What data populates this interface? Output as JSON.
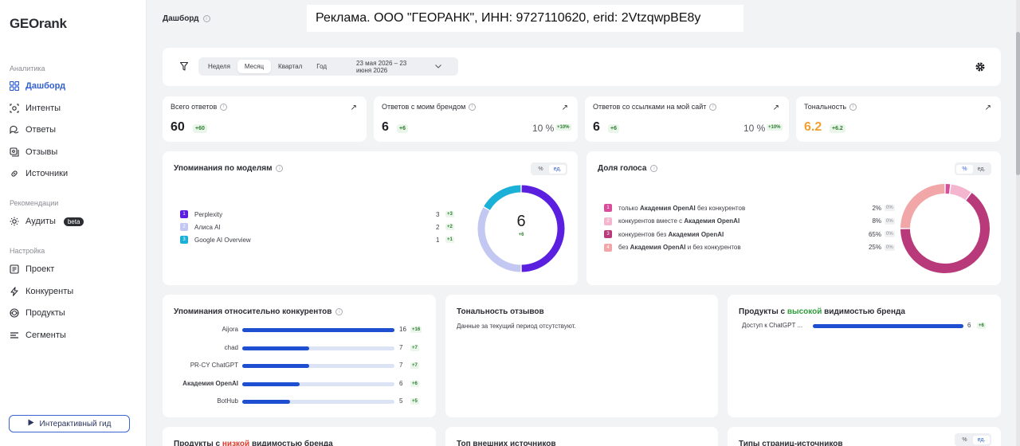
{
  "app": {
    "logo": "GEOrank"
  },
  "ad": "Реклама. ООО \"ГЕОРАНК\", ИНН: 9727110620, erid: 2VtzqwpBE8y",
  "sidebar": {
    "sections": [
      {
        "title": "Аналитика"
      },
      {
        "title": "Рекомендации"
      },
      {
        "title": "Настройка"
      }
    ],
    "items": [
      {
        "label": "Дашборд",
        "icon": "dashboard-icon"
      },
      {
        "label": "Интенты",
        "icon": "intents-icon"
      },
      {
        "label": "Ответы",
        "icon": "answers-icon"
      },
      {
        "label": "Отзывы",
        "icon": "reviews-icon"
      },
      {
        "label": "Источники",
        "icon": "sources-icon"
      },
      {
        "label": "Аудиты",
        "icon": "sun-icon",
        "badge": "beta"
      },
      {
        "label": "Проект",
        "icon": "project-icon"
      },
      {
        "label": "Конкуренты",
        "icon": "lightning-icon"
      },
      {
        "label": "Продукты",
        "icon": "products-icon"
      },
      {
        "label": "Сегменты",
        "icon": "segments-icon"
      }
    ],
    "guide_button": "Интерактивный гид"
  },
  "header": {
    "title": "Дашборд"
  },
  "filters": {
    "periods": [
      "Неделя",
      "Месяц",
      "Квартал",
      "Год"
    ],
    "selected": "Месяц",
    "date_range": "23 мая 2026 – 23 июня 2026"
  },
  "kpis": [
    {
      "title": "Всего ответов",
      "value": "60",
      "delta": "+60"
    },
    {
      "title": "Ответов с моим брендом",
      "value": "6",
      "delta": "+6",
      "pct": "10 %",
      "pct_delta": "+10%"
    },
    {
      "title": "Ответов со ссылками на мой сайт",
      "value": "6",
      "delta": "+6",
      "pct": "10 %",
      "pct_delta": "+10%"
    },
    {
      "title": "Тональность",
      "value": "6.2",
      "delta": "+6.2",
      "value_color": "#f0a030"
    }
  ],
  "mentions_by_model": {
    "title": "Упоминания по моделям",
    "toggle": [
      "%",
      "ед."
    ],
    "total": "6",
    "total_delta": "+6",
    "rows": [
      {
        "n": "1",
        "name": "Perplexity",
        "value": 3,
        "value_text": "3",
        "delta": "+3",
        "color": "#5b1fe0"
      },
      {
        "n": "2",
        "name": "Алиса AI",
        "value": 2,
        "value_text": "2",
        "delta": "+2",
        "color": "#c2c8f2"
      },
      {
        "n": "3",
        "name": "Google AI Overview",
        "value": 1,
        "value_text": "1",
        "delta": "+1",
        "color": "#1bb0d8"
      }
    ]
  },
  "voice_share": {
    "title": "Доля голоса",
    "toggle": [
      "%",
      "ед."
    ],
    "rows": [
      {
        "n": "1",
        "pre": "только ",
        "bold": "Академия OpenAI",
        "post": " без конкурентов",
        "value": 2,
        "pct": "2%",
        "change": "0%",
        "color": "#d84d9a"
      },
      {
        "n": "2",
        "pre": "конкурентов вместе с ",
        "bold": "Академия OpenAI",
        "post": "",
        "value": 8,
        "pct": "8%",
        "change": "0%",
        "color": "#f4b6cf"
      },
      {
        "n": "3",
        "pre": "конкурентов без ",
        "bold": "Академия OpenAI",
        "post": "",
        "value": 65,
        "pct": "65%",
        "change": "0%",
        "color": "#b83a7a"
      },
      {
        "n": "4",
        "pre": "без ",
        "bold": "Академия OpenAI",
        "post": " и без конкурентов",
        "value": 25,
        "pct": "25%",
        "change": "0%",
        "color": "#f1a6a8"
      }
    ]
  },
  "competitor_mentions": {
    "title": "Упоминания относительно конкурентов",
    "max": 16,
    "rows": [
      {
        "name": "Aijora",
        "value": 16,
        "value_text": "16",
        "delta": "+16",
        "bold": false
      },
      {
        "name": "chad",
        "value": 7,
        "value_text": "7",
        "delta": "+7",
        "bold": false
      },
      {
        "name": "PR-CY ChatGPT",
        "value": 7,
        "value_text": "7",
        "delta": "+7",
        "bold": false
      },
      {
        "name": "Академия OpenAI",
        "value": 6,
        "value_text": "6",
        "delta": "+6",
        "bold": true
      },
      {
        "name": "BotHub",
        "value": 5,
        "value_text": "5",
        "delta": "+5",
        "bold": false
      }
    ]
  },
  "reviews_tone": {
    "title": "Тональность отзывов",
    "empty": "Данные за текущий период отсутствуют."
  },
  "high_visibility": {
    "title_pre": "Продукты с ",
    "title_hl": "высокой",
    "title_post": " видимостью бренда",
    "hl_color": "#2e9d3a",
    "max": 6,
    "rows": [
      {
        "name": "Доступ к ChatGPT ...",
        "value": 6,
        "value_text": "6",
        "delta": "+6"
      }
    ]
  },
  "bottom": {
    "low_pre": "Продукты с ",
    "low_hl": "низкой",
    "low_post": " видимостью бренда",
    "low_color": "#e0392b",
    "top_sources": "Топ внешних источников",
    "page_types": "Типы страниц-источников",
    "toggle": [
      "%",
      "ед."
    ]
  }
}
